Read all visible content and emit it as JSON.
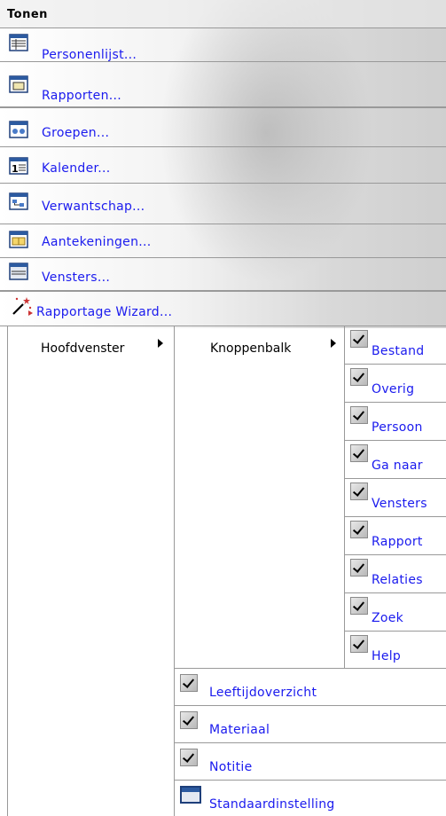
{
  "title": "Tonen",
  "menu": [
    {
      "label": "Personenlijst...",
      "icon": "person-list-icon"
    },
    {
      "label": "Rapporten...",
      "icon": "reports-icon"
    },
    {
      "label": "Groepen...",
      "icon": "groups-icon"
    },
    {
      "label": "Kalender...",
      "icon": "calendar-icon"
    },
    {
      "label": "Verwantschap...",
      "icon": "relationship-icon"
    },
    {
      "label": "Aantekeningen...",
      "icon": "notes-icon"
    },
    {
      "label": "Vensters...",
      "icon": "windows-icon"
    },
    {
      "label": "Rapportage Wizard...",
      "icon": "wizard-wand-icon"
    }
  ],
  "submenu": {
    "hoofdvenster": "Hoofdvenster",
    "knoppenbalk": "Knoppenbalk",
    "toolbar_items": [
      {
        "label": "Bestand",
        "checked": true
      },
      {
        "label": "Overig",
        "checked": true
      },
      {
        "label": "Persoon",
        "checked": true
      },
      {
        "label": "Ga naar",
        "checked": true
      },
      {
        "label": "Vensters",
        "checked": true
      },
      {
        "label": "Rapport",
        "checked": true
      },
      {
        "label": "Relaties",
        "checked": true
      },
      {
        "label": "Zoek",
        "checked": true
      },
      {
        "label": "Help",
        "checked": true
      }
    ],
    "main_items": [
      {
        "label": "Leeftijdoverzicht",
        "checked": true
      },
      {
        "label": "Materiaal",
        "checked": true
      },
      {
        "label": "Notitie",
        "checked": true
      },
      {
        "label": "Standaardinstelling",
        "checked": false
      }
    ]
  },
  "colors": {
    "link": "#1a1aee",
    "border": "#999999"
  }
}
